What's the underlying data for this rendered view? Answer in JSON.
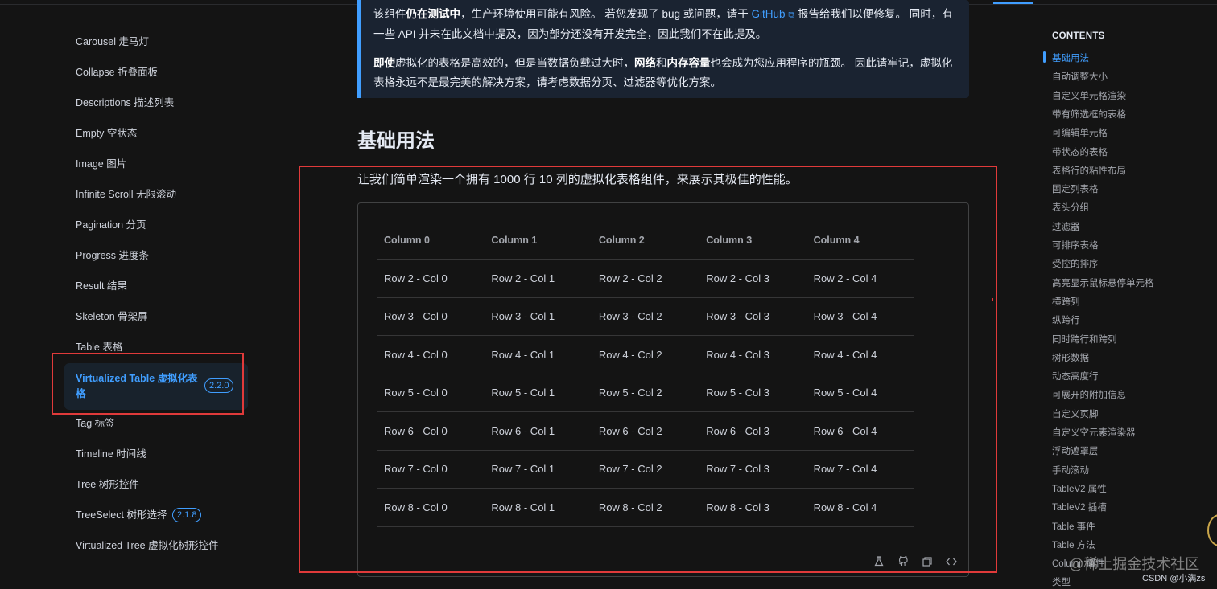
{
  "sidebar": {
    "items": [
      {
        "label": "Carousel 走马灯"
      },
      {
        "label": "Collapse 折叠面板"
      },
      {
        "label": "Descriptions 描述列表"
      },
      {
        "label": "Empty 空状态"
      },
      {
        "label": "Image 图片"
      },
      {
        "label": "Infinite Scroll 无限滚动"
      },
      {
        "label": "Pagination 分页"
      },
      {
        "label": "Progress 进度条"
      },
      {
        "label": "Result 结果"
      },
      {
        "label": "Skeleton 骨架屏"
      },
      {
        "label": "Table 表格"
      },
      {
        "label": "Tag 标签"
      },
      {
        "label": "Timeline 时间线"
      },
      {
        "label": "Tree 树形控件"
      },
      {
        "label": "TreeSelect 树形选择"
      },
      {
        "label": "Virtualized Tree 虚拟化树形控件"
      }
    ],
    "active": {
      "label": "Virtualized Table 虚拟化表格",
      "badge": "2.2.0"
    },
    "treeselect_badge": "2.1.8"
  },
  "tip": {
    "p1_a": "该组件",
    "p1_b": "仍在测试中",
    "p1_c": "，生产环境使用可能有风险。 若您发现了 bug 或问题，请于 ",
    "p1_link": "GitHub",
    "p1_d": " 报告给我们以便修复。 同时，有一些 API 并未在此文档中提及，因为部分还没有开发完全，因此我们不在此提及。",
    "p2_a": "即使",
    "p2_b": "虚拟化的表格是高效的，但是当数据负载过大时，",
    "p2_c": "网络",
    "p2_d": "和",
    "p2_e": "内存容量",
    "p2_f": "也会成为您应用程序的瓶颈。 因此请牢记，虚拟化表格永远不是最完美的解决方案，请考虑数据分页、过滤器等优化方案。"
  },
  "section": {
    "title": "基础用法",
    "description": "让我们简单渲染一个拥有 1000 行 10 列的虚拟化表格组件，来展示其极佳的性能。"
  },
  "table": {
    "headers": [
      "Column 0",
      "Column 1",
      "Column 2",
      "Column 3",
      "Column 4"
    ],
    "rows": [
      [
        "Row 2 - Col 0",
        "Row 2 - Col 1",
        "Row 2 - Col 2",
        "Row 2 - Col 3",
        "Row 2 - Col 4"
      ],
      [
        "Row 3 - Col 0",
        "Row 3 - Col 1",
        "Row 3 - Col 2",
        "Row 3 - Col 3",
        "Row 3 - Col 4"
      ],
      [
        "Row 4 - Col 0",
        "Row 4 - Col 1",
        "Row 4 - Col 2",
        "Row 4 - Col 3",
        "Row 4 - Col 4"
      ],
      [
        "Row 5 - Col 0",
        "Row 5 - Col 1",
        "Row 5 - Col 2",
        "Row 5 - Col 3",
        "Row 5 - Col 4"
      ],
      [
        "Row 6 - Col 0",
        "Row 6 - Col 1",
        "Row 6 - Col 2",
        "Row 6 - Col 3",
        "Row 6 - Col 4"
      ],
      [
        "Row 7 - Col 0",
        "Row 7 - Col 1",
        "Row 7 - Col 2",
        "Row 7 - Col 3",
        "Row 7 - Col 4"
      ],
      [
        "Row 8 - Col 0",
        "Row 8 - Col 1",
        "Row 8 - Col 2",
        "Row 8 - Col 3",
        "Row 8 - Col 4"
      ]
    ]
  },
  "toolbar": {
    "icons": [
      "flask-icon",
      "github-icon",
      "copy-icon",
      "code-icon"
    ]
  },
  "toc": {
    "title": "CONTENTS",
    "items": [
      {
        "label": "基础用法",
        "active": true
      },
      {
        "label": "自动调整大小"
      },
      {
        "label": "自定义单元格渲染"
      },
      {
        "label": "带有筛选框的表格"
      },
      {
        "label": "可编辑单元格"
      },
      {
        "label": "带状态的表格"
      },
      {
        "label": "表格行的粘性布局"
      },
      {
        "label": "固定列表格"
      },
      {
        "label": "表头分组"
      },
      {
        "label": "过滤器"
      },
      {
        "label": "可排序表格"
      },
      {
        "label": "受控的排序"
      },
      {
        "label": "高亮显示鼠标悬停单元格"
      },
      {
        "label": "横跨列"
      },
      {
        "label": "纵跨行"
      },
      {
        "label": "同时跨行和跨列"
      },
      {
        "label": "树形数据"
      },
      {
        "label": "动态高度行"
      },
      {
        "label": "可展开的附加信息"
      },
      {
        "label": "自定义页脚"
      },
      {
        "label": "自定义空元素渲染器"
      },
      {
        "label": "浮动遮罩层"
      },
      {
        "label": "手动滚动"
      },
      {
        "label": "TableV2 属性"
      },
      {
        "label": "TableV2 插槽"
      },
      {
        "label": "Table 事件"
      },
      {
        "label": "Table 方法"
      },
      {
        "label": "Column 属性"
      },
      {
        "label": "类型"
      }
    ]
  },
  "watermark": {
    "main": "@稀土掘金技术社区",
    "sub": "CSDN @小满zs"
  },
  "colors": {
    "accent": "#409eff",
    "annotation_red": "#e03a3a",
    "background": "#141414"
  }
}
